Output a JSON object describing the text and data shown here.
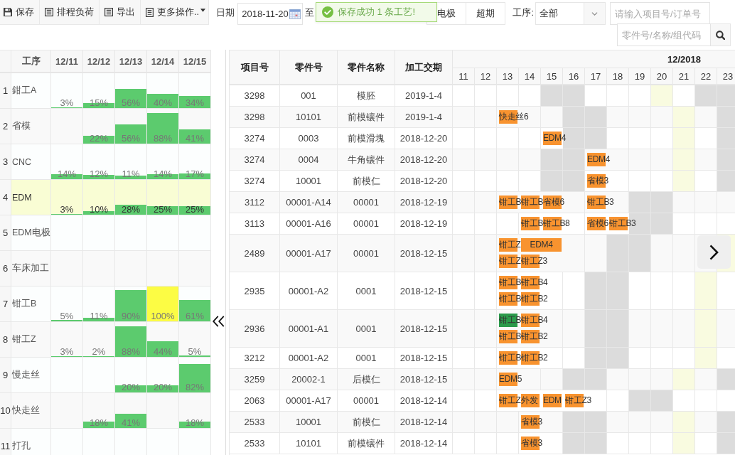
{
  "toolbar": {
    "buttons": [
      {
        "label": "保存",
        "kind": "save",
        "caret": false
      },
      {
        "label": "排程负荷",
        "kind": "list",
        "caret": false
      },
      {
        "label": "导出",
        "kind": "list",
        "caret": false
      },
      {
        "label": "更多操作..",
        "kind": "document",
        "caret": true
      }
    ],
    "date_label": "日期",
    "date_from": "2018-11-20",
    "to_label": "至",
    "filters": [
      "电极",
      "超期"
    ],
    "process_label": "工序:",
    "process_value": "全部",
    "order_search": {
      "placeholder": "请输入项目号/订单号"
    },
    "part_search": {
      "placeholder": "零件号/名称/组代码"
    }
  },
  "toast": {
    "text": "保存成功 1 条工艺!"
  },
  "load_table": {
    "columns": [
      "工序",
      "12/11",
      "12/12",
      "12/13",
      "12/14",
      "12/15"
    ],
    "rows": [
      {
        "index": "1",
        "name": "鉗工A",
        "selected": false,
        "loads": [
          {
            "kind": "bar",
            "label": "3%",
            "level": 0.03,
            "color": "#5ccb6e"
          },
          {
            "kind": "bar",
            "label": "15%",
            "level": 0.15,
            "color": "#5ccb6e"
          },
          {
            "kind": "bar",
            "label": "56%",
            "level": 0.56,
            "color": "#5ccb6e"
          },
          {
            "kind": "bar",
            "label": "40%",
            "level": 0.4,
            "color": "#5ccb6e"
          },
          {
            "kind": "bar",
            "label": "34%",
            "level": 0.34,
            "color": "#5ccb6e"
          }
        ]
      },
      {
        "index": "2",
        "name": "省模",
        "selected": false,
        "loads": [
          {
            "kind": "empty"
          },
          {
            "kind": "bar",
            "label": "22%",
            "level": 0.22,
            "color": "#5ccb6e"
          },
          {
            "kind": "bar",
            "label": "56%",
            "level": 0.56,
            "color": "#5ccb6e"
          },
          {
            "kind": "bar",
            "label": "88%",
            "level": 0.88,
            "color": "#5ccb6e"
          },
          {
            "kind": "bar",
            "label": "41%",
            "level": 0.41,
            "color": "#5ccb6e"
          }
        ]
      },
      {
        "index": "3",
        "name": "CNC",
        "selected": false,
        "loads": [
          {
            "kind": "bar",
            "label": "14%",
            "level": 0.14,
            "color": "#5ccb6e"
          },
          {
            "kind": "bar",
            "label": "12%",
            "level": 0.12,
            "color": "#5ccb6e"
          },
          {
            "kind": "bar",
            "label": "11%",
            "level": 0.11,
            "color": "#5ccb6e"
          },
          {
            "kind": "bar",
            "label": "14%",
            "level": 0.14,
            "color": "#5ccb6e"
          },
          {
            "kind": "bar",
            "label": "17%",
            "level": 0.17,
            "color": "#5ccb6e"
          }
        ]
      },
      {
        "index": "4",
        "name": "EDM",
        "selected": true,
        "loads": [
          {
            "kind": "bar",
            "label": "3%",
            "level": 0.03,
            "color": "#5ccb6e"
          },
          {
            "kind": "bar",
            "label": "10%",
            "level": 0.1,
            "color": "#5ccb6e"
          },
          {
            "kind": "bar",
            "label": "28%",
            "level": 0.28,
            "color": "#5ccb6e"
          },
          {
            "kind": "bar",
            "label": "25%",
            "level": 0.25,
            "color": "#5ccb6e"
          },
          {
            "kind": "bar",
            "label": "25%",
            "level": 0.25,
            "color": "#5ccb6e"
          }
        ]
      },
      {
        "index": "5",
        "name": "EDM电极",
        "selected": false
      },
      {
        "index": "6",
        "name": "车床加工",
        "selected": false
      },
      {
        "index": "7",
        "name": "钳工B",
        "selected": false,
        "loads": [
          {
            "kind": "bar",
            "label": "5%",
            "level": 0.05,
            "color": "#5ccb6e"
          },
          {
            "kind": "bar",
            "label": "11%",
            "level": 0.11,
            "color": "#5ccb6e"
          },
          {
            "kind": "bar",
            "label": "90%",
            "level": 0.9,
            "color": "#5ccb6e"
          },
          {
            "kind": "bar",
            "label": "100%",
            "level": 1,
            "color": "#fcfc44"
          },
          {
            "kind": "bar",
            "label": "61%",
            "level": 0.61,
            "color": "#5ccb6e"
          }
        ]
      },
      {
        "index": "8",
        "name": "钳工Z",
        "selected": false,
        "loads": [
          {
            "kind": "bar",
            "label": "3%",
            "level": 0.03,
            "color": "#5ccb6e"
          },
          {
            "kind": "bar",
            "label": "2%",
            "level": 0.02,
            "color": "#5ccb6e"
          },
          {
            "kind": "bar",
            "label": "88%",
            "level": 0.88,
            "color": "#5ccb6e"
          },
          {
            "kind": "bar",
            "label": "44%",
            "level": 0.44,
            "color": "#5ccb6e"
          },
          {
            "kind": "bar",
            "label": "5%",
            "level": 0.05,
            "color": "#5ccb6e"
          }
        ]
      },
      {
        "index": "9",
        "name": "慢走丝",
        "selected": false,
        "loads": [
          {
            "kind": "empty"
          },
          {
            "kind": "empty"
          },
          {
            "kind": "bar",
            "label": "20%",
            "level": 0.2,
            "color": "#5ccb6e"
          },
          {
            "kind": "bar",
            "label": "20%",
            "level": 0.2,
            "color": "#5ccb6e"
          },
          {
            "kind": "bar",
            "label": "82%",
            "level": 0.82,
            "color": "#5ccb6e"
          }
        ]
      },
      {
        "index": "10",
        "name": "快走丝",
        "selected": false,
        "loads": [
          {
            "kind": "empty"
          },
          {
            "kind": "bar",
            "label": "18%",
            "level": 0.18,
            "color": "#5ccb6e"
          },
          {
            "kind": "bar",
            "label": "41%",
            "level": 0.41,
            "color": "#5ccb6e"
          },
          {
            "kind": "empty"
          },
          {
            "kind": "bar",
            "label": "18%",
            "level": 0.18,
            "color": "#5ccb6e"
          }
        ]
      },
      {
        "index": "11",
        "name": "打孔",
        "selected": false
      }
    ]
  },
  "schedule": {
    "columns": [
      "项目号",
      "零件号",
      "零件名称",
      "加工交期"
    ],
    "month": "12/2018",
    "days": [
      {
        "label": "11",
        "kind": "workday"
      },
      {
        "label": "12",
        "kind": "workday"
      },
      {
        "label": "13",
        "kind": "workday"
      },
      {
        "label": "14",
        "kind": "workday"
      },
      {
        "label": "15",
        "kind": "weekend"
      },
      {
        "label": "16",
        "kind": "weekend"
      },
      {
        "label": "17",
        "kind": "workday"
      },
      {
        "label": "18",
        "kind": "workday"
      },
      {
        "label": "19",
        "kind": "workday"
      },
      {
        "label": "20",
        "kind": "highlight"
      },
      {
        "label": "21",
        "kind": "workday"
      },
      {
        "label": "22",
        "kind": "weekend"
      },
      {
        "label": "23",
        "kind": "weekend"
      }
    ],
    "rows": [
      {
        "cells": [
          "3298",
          "001",
          "模胚",
          "2019-1-4"
        ]
      },
      {
        "cells": [
          "3298",
          "10101",
          "前模镶件",
          "2019-1-4"
        ],
        "lanes": [
          [
            {
              "kind": "empty"
            },
            {
              "kind": "empty"
            },
            {
              "text": "快走丝6",
              "color": "#f8932f",
              "kind": "short"
            }
          ]
        ]
      },
      {
        "cells": [
          "3274",
          "0003",
          "前模滑塊",
          "2018-12-20"
        ],
        "lanes": [
          [
            {
              "kind": "empty"
            },
            {
              "kind": "empty"
            },
            {
              "kind": "empty"
            },
            {
              "kind": "empty"
            },
            {
              "text": "EDM4",
              "color": "#f8932f",
              "kind": "short"
            }
          ]
        ]
      },
      {
        "cells": [
          "3274",
          "0004",
          "牛角镶件",
          "2018-12-20"
        ],
        "lanes": [
          [
            {
              "kind": "empty"
            },
            {
              "kind": "empty"
            },
            {
              "kind": "empty"
            },
            {
              "kind": "empty"
            },
            {
              "kind": "empty"
            },
            {
              "kind": "empty"
            },
            {
              "text": "EDM4",
              "color": "#f8932f",
              "kind": "short"
            }
          ]
        ]
      },
      {
        "cells": [
          "3274",
          "10001",
          "前模仁",
          "2018-12-20"
        ],
        "lanes": [
          [
            {
              "kind": "empty"
            },
            {
              "kind": "empty"
            },
            {
              "kind": "empty"
            },
            {
              "kind": "empty"
            },
            {
              "kind": "empty"
            },
            {
              "kind": "empty"
            },
            {
              "text": "省模3",
              "color": "#f8932f",
              "kind": "short"
            }
          ]
        ]
      },
      {
        "cells": [
          "3112",
          "00001-A14",
          "00001",
          "2018-12-19"
        ],
        "lanes": [
          [
            {
              "kind": "empty"
            },
            {
              "kind": "empty"
            },
            {
              "text": "钳工B",
              "color": "#f8932f",
              "kind": "short"
            },
            {
              "text": "钳工B",
              "color": "#f8932f",
              "kind": "short"
            },
            {
              "text": "省模6",
              "color": "#f8932f",
              "kind": "short"
            },
            {
              "kind": "empty"
            },
            {
              "text": "钳工B3",
              "color": "#f8932f",
              "kind": "short"
            }
          ]
        ]
      },
      {
        "cells": [
          "3113",
          "00001-A16",
          "00001",
          "2018-12-19"
        ],
        "lanes": [
          [
            {
              "kind": "empty"
            },
            {
              "kind": "empty"
            },
            {
              "kind": "empty"
            },
            {
              "text": "钳工B",
              "color": "#f8932f",
              "kind": "short"
            },
            {
              "text": "钳工B8",
              "color": "#f8932f",
              "kind": "short"
            },
            {
              "kind": "empty"
            },
            {
              "text": "省模6",
              "color": "#f8932f",
              "kind": "short"
            },
            {
              "text": "钳工B3",
              "color": "#f8932f",
              "kind": "short"
            }
          ]
        ]
      },
      {
        "cells": [
          "2489",
          "00001-A17",
          "00001",
          "2018-12-15"
        ],
        "lanes": [
          [
            {
              "kind": "empty"
            },
            {
              "kind": "empty"
            },
            {
              "text": "钳工Z",
              "color": "#f8932f",
              "kind": "short"
            },
            {
              "text": "EDM4",
              "color": "#f8932f",
              "kind": "long"
            }
          ],
          [
            {
              "kind": "empty"
            },
            {
              "kind": "empty"
            },
            {
              "text": "钳工Z",
              "color": "#f8932f",
              "kind": "short"
            },
            {
              "text": "钳工Z3",
              "color": "#f8932f",
              "kind": "short"
            }
          ]
        ]
      },
      {
        "cells": [
          "2935",
          "00001-A2",
          "0001",
          "2018-12-15"
        ],
        "lanes": [
          [
            {
              "kind": "empty"
            },
            {
              "kind": "empty"
            },
            {
              "text": "钳工B",
              "color": "#f8932f",
              "kind": "short"
            },
            {
              "text": "钳工B4",
              "color": "#f8932f",
              "kind": "short"
            }
          ],
          [
            {
              "kind": "empty"
            },
            {
              "kind": "empty"
            },
            {
              "text": "钳工B",
              "color": "#f8932f",
              "kind": "short"
            },
            {
              "text": "钳工B2",
              "color": "#f8932f",
              "kind": "short"
            }
          ]
        ]
      },
      {
        "cells": [
          "2936",
          "00001-A1",
          "0001",
          "2018-12-15"
        ],
        "lanes": [
          [
            {
              "kind": "empty"
            },
            {
              "kind": "empty"
            },
            {
              "text": "钳工B",
              "color": "#2a9a4a",
              "kind": "short"
            },
            {
              "text": "钳工B4",
              "color": "#f8932f",
              "kind": "short"
            }
          ],
          [
            {
              "kind": "empty"
            },
            {
              "kind": "empty"
            },
            {
              "text": "钳工B",
              "color": "#f8932f",
              "kind": "short"
            },
            {
              "text": "钳工B2",
              "color": "#f8932f",
              "kind": "short"
            }
          ]
        ]
      },
      {
        "cells": [
          "3212",
          "00001-A2",
          "0001",
          "2018-12-15"
        ],
        "lanes": [
          [
            {
              "kind": "empty"
            },
            {
              "kind": "empty"
            },
            {
              "text": "钳工B",
              "color": "#f8932f",
              "kind": "short"
            },
            {
              "text": "钳工B2",
              "color": "#f8932f",
              "kind": "short"
            }
          ]
        ]
      },
      {
        "cells": [
          "3259",
          "20002-1",
          "后模仁",
          "2018-12-15"
        ],
        "lanes": [
          [
            {
              "kind": "empty"
            },
            {
              "kind": "empty"
            },
            {
              "text": "EDM5",
              "color": "#f8932f",
              "kind": "short"
            }
          ]
        ]
      },
      {
        "cells": [
          "2063",
          "00001-A17",
          "00001",
          "2018-12-14"
        ],
        "lanes": [
          [
            {
              "kind": "empty"
            },
            {
              "kind": "empty"
            },
            {
              "text": "钳工Z",
              "color": "#f8932f",
              "kind": "short"
            },
            {
              "text": "外发",
              "color": "#f8932f",
              "kind": "short"
            },
            {
              "text": "EDM",
              "color": "#f8932f",
              "kind": "short"
            },
            {
              "text": "钳工Z3",
              "color": "#f8932f",
              "kind": "short"
            }
          ]
        ]
      },
      {
        "cells": [
          "2533",
          "10001",
          "前模仁",
          "2018-12-14"
        ],
        "lanes": [
          [
            {
              "kind": "empty"
            },
            {
              "kind": "empty"
            },
            {
              "kind": "empty"
            },
            {
              "text": "省模3",
              "color": "#f8932f",
              "kind": "short"
            }
          ]
        ]
      },
      {
        "cells": [
          "2533",
          "10101",
          "前模镶件",
          "2018-12-14"
        ],
        "lanes": [
          [
            {
              "kind": "empty"
            },
            {
              "kind": "empty"
            },
            {
              "kind": "empty"
            },
            {
              "text": "省模3",
              "color": "#f8932f",
              "kind": "short"
            }
          ]
        ]
      }
    ]
  }
}
